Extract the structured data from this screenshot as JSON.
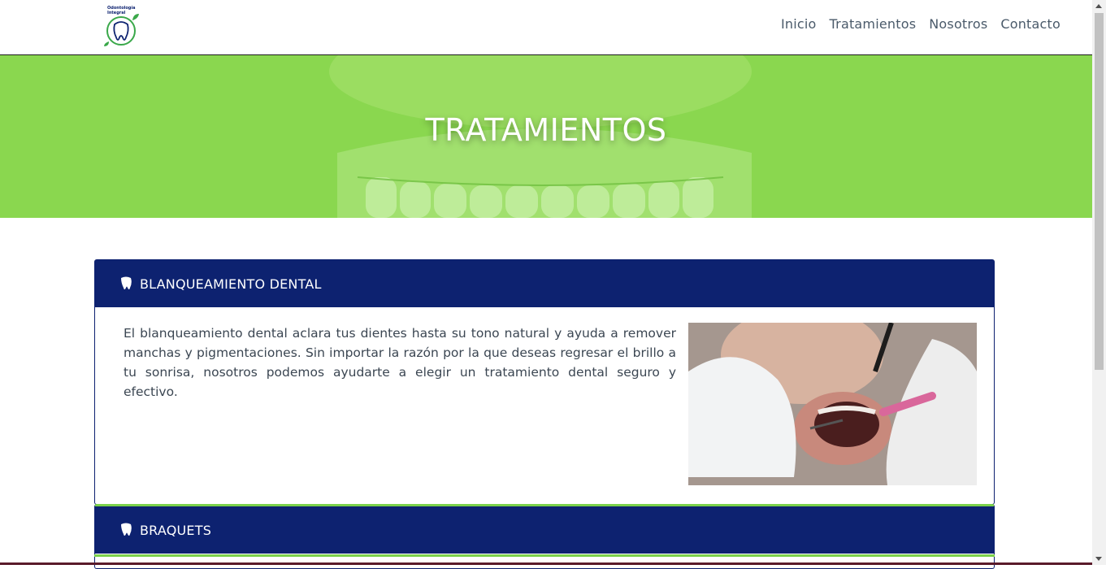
{
  "header": {
    "logo_text": [
      "Odontología",
      "Integral"
    ],
    "nav": [
      {
        "label": "Inicio"
      },
      {
        "label": "Tratamientos"
      },
      {
        "label": "Nosotros"
      },
      {
        "label": "Contacto"
      }
    ]
  },
  "hero": {
    "title": "TRATAMIENTOS",
    "overlay_color": "#8ad74f"
  },
  "cards": [
    {
      "title": "BLANQUEAMIENTO DENTAL",
      "icon": "tooth-icon",
      "description": "El blanqueamiento dental aclara tus dientes hasta su tono natural y ayuda a remover manchas y pigmentaciones. Sin importar la razón por la que deseas regresar el brillo a tu sonrisa, nosotros podemos ayudarte a elegir un tratamiento dental seguro y efectivo."
    },
    {
      "title": "BRAQUETS",
      "icon": "tooth-icon"
    }
  ],
  "colors": {
    "primary_navy": "#0d2270",
    "accent_green": "#7ad14a",
    "text": "#3b4652"
  }
}
